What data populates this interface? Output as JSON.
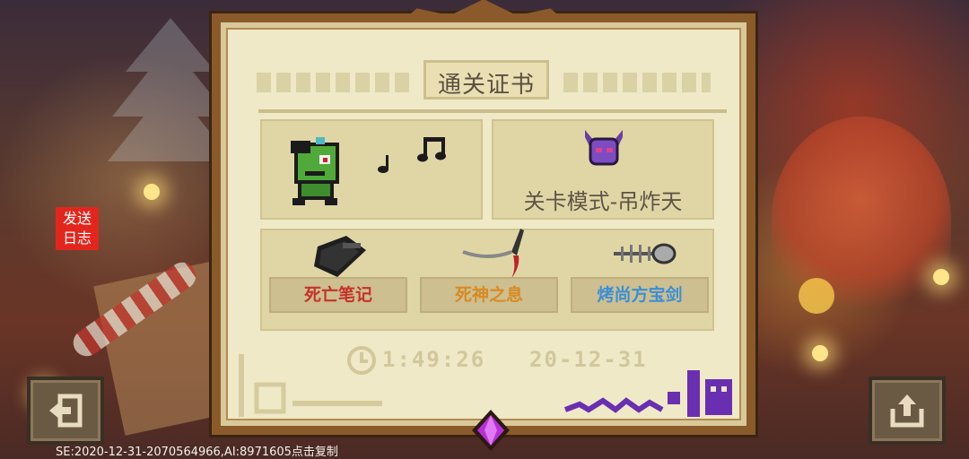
{
  "side": {
    "log_button_line1": "发送",
    "log_button_line2": "日志",
    "left_button_icon": "exit-door-icon",
    "right_button_icon": "share-upload-icon"
  },
  "certificate": {
    "title": "通关证书",
    "mode_label": "关卡模式-吊炸天",
    "character_icon": "green-zombie-character-icon",
    "notes_icon": "music-notes-icon",
    "mode_icon": "purple-demon-mask-icon",
    "items": [
      {
        "label": "死亡笔记",
        "icon": "black-notebook-icon",
        "color": "#c4332b"
      },
      {
        "label": "死神之息",
        "icon": "scythe-weapon-icon",
        "color": "#d88a22"
      },
      {
        "label": "烤尚方宝剑",
        "icon": "fish-bone-sword-icon",
        "color": "#3b8fd6"
      }
    ],
    "time": "1:49:26",
    "date": "20-12-31",
    "time_icon": "clock-icon",
    "bottom_gem_icon": "purple-gem-icon"
  },
  "footer": {
    "text": "SE:2020-12-31-2070564966,AI:8971605点击复制"
  }
}
